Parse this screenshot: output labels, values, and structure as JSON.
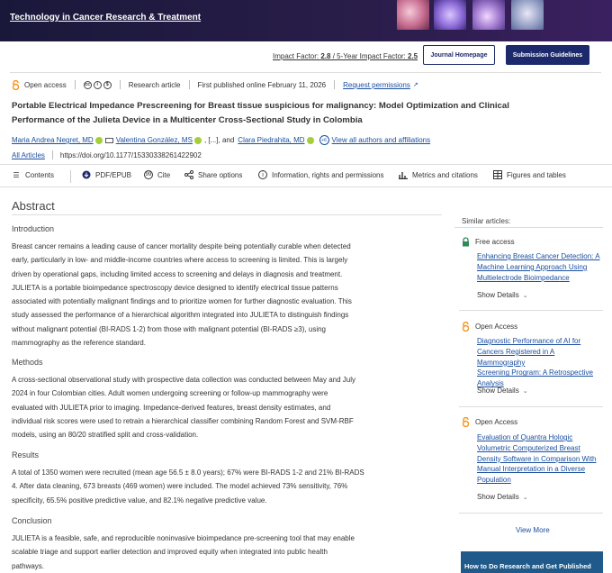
{
  "header": {
    "journal_title": "Technology in Cancer Research & Treatment",
    "impact_prefix": "Impact Factor: ",
    "impact_factor": "2.8",
    "impact_mid": " / 5-Year Impact Factor: ",
    "five_year_impact": "2.5",
    "journal_homepage": "Journal Homepage",
    "submission_guidelines": "Submission Guidelines"
  },
  "meta": {
    "open_access": "Open access",
    "article_type": "Research article",
    "published": "First published online February 11, 2026",
    "request_permissions": "Request permissions"
  },
  "article": {
    "title": "Portable Electrical Impedance Prescreening for Breast tissue suspicious for malignancy: Model Optimization and Clinical Performance of the Julieta Device in a Multicenter Cross-Sectional Study in Colombia",
    "author1": "Maria Andrea Negret, MD",
    "author2": "Valentina González, MS",
    "ellipsis": ", [...], and",
    "author3": "Clara Piedrahita, MD",
    "plus_count": "+6",
    "view_all": "View all authors and affiliations",
    "all_articles": "All Articles",
    "doi": "https://doi.org/10.1177/15330338261422902"
  },
  "toolbar": {
    "contents": "Contents",
    "pdf": "PDF/EPUB",
    "cite": "Cite",
    "share": "Share options",
    "info": "Information, rights and permissions",
    "metrics": "Metrics and citations",
    "figures": "Figures and tables"
  },
  "abstract": {
    "heading": "Abstract",
    "intro_h": "Introduction",
    "intro_lines": [
      "Breast cancer remains a leading cause of cancer mortality despite being potentially curable when detected",
      "early, particularly in low- and middle-income countries where access to screening is limited. This is largely",
      "driven by operational gaps, including limited access to screening and delays in diagnosis and treatment.",
      "JULIETA is a portable bioimpedance spectroscopy device designed to identify electrical tissue patterns",
      "associated with potentially malignant findings and to prioritize women for further diagnostic evaluation. This",
      "study assessed the performance of a hierarchical algorithm integrated into JULIETA to distinguish findings",
      "without malignant potential (BI-RADS 1-2) from those with malignant potential (BI-RADS ≥3), using",
      "mammography as the reference standard."
    ],
    "methods_h": "Methods",
    "methods_lines": [
      "A cross-sectional observational study with prospective data collection was conducted between May and July",
      "2024 in four Colombian cities. Adult women undergoing screening or follow-up mammography were",
      "evaluated with JULIETA prior to imaging. Impedance-derived features, breast density estimates, and",
      "individual risk scores were used to retrain a hierarchical classifier combining Random Forest and SVM-RBF",
      "models, using an 80/20 stratified split and cross-validation."
    ],
    "results_h": "Results",
    "results_lines": [
      "A total of 1350 women were recruited (mean age 56.5 ± 8.0 years); 67% were BI-RADS 1-2 and 21% BI-RADS",
      "4. After data cleaning, 673 breasts (469 women) were included. The model achieved 73% sensitivity, 76%",
      "specificity, 65.5% positive predictive value, and 82.1% negative predictive value."
    ],
    "conclusion_h": "Conclusion",
    "conclusion_lines": [
      "JULIETA is a feasible, safe, and reproducible noninvasive bioimpedance pre-screening tool that may enable",
      "scalable triage and support earlier detection and improved equity when integrated into public health",
      "pathways."
    ]
  },
  "sidebar": {
    "heading": "Similar articles:",
    "items": [
      {
        "access": "Free access",
        "lines": [
          "Enhancing Breast Cancer Detection: A",
          "Machine Learning Approach Using",
          "Multielectrode Bioimpedance"
        ],
        "show": "Show Details"
      },
      {
        "access": "Open Access",
        "lines": [
          "Diagnostic Performance of AI for",
          "Cancers Registered in A Mammography",
          "Screening Program: A Retrospective",
          "Analysis"
        ],
        "show": "Show Details"
      },
      {
        "access": "Open Access",
        "lines": [
          "Evaluation of Quantra Hologic",
          "Volumetric Computerized Breast",
          "Density Software in Comparison With",
          "Manual Interpretation in a Diverse",
          "Population"
        ],
        "show": "Show Details"
      }
    ],
    "view_more": "View More",
    "ad_text": "How to Do Research and Get Published"
  }
}
